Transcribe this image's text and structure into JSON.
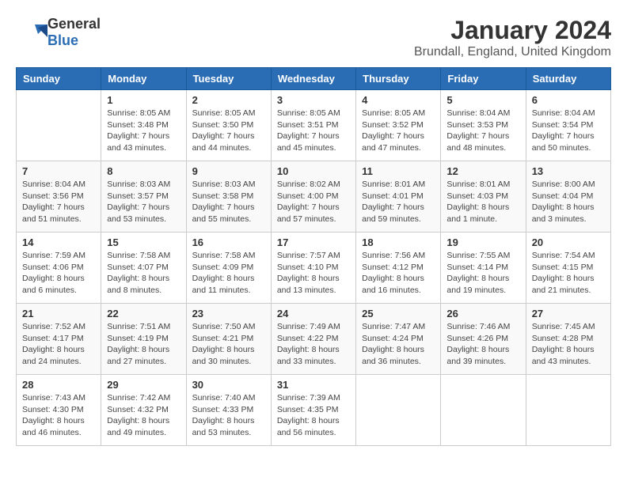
{
  "header": {
    "logo_general": "General",
    "logo_blue": "Blue",
    "month": "January 2024",
    "location": "Brundall, England, United Kingdom"
  },
  "days_of_week": [
    "Sunday",
    "Monday",
    "Tuesday",
    "Wednesday",
    "Thursday",
    "Friday",
    "Saturday"
  ],
  "weeks": [
    [
      {
        "day": "",
        "info": ""
      },
      {
        "day": "1",
        "info": "Sunrise: 8:05 AM\nSunset: 3:48 PM\nDaylight: 7 hours\nand 43 minutes."
      },
      {
        "day": "2",
        "info": "Sunrise: 8:05 AM\nSunset: 3:50 PM\nDaylight: 7 hours\nand 44 minutes."
      },
      {
        "day": "3",
        "info": "Sunrise: 8:05 AM\nSunset: 3:51 PM\nDaylight: 7 hours\nand 45 minutes."
      },
      {
        "day": "4",
        "info": "Sunrise: 8:05 AM\nSunset: 3:52 PM\nDaylight: 7 hours\nand 47 minutes."
      },
      {
        "day": "5",
        "info": "Sunrise: 8:04 AM\nSunset: 3:53 PM\nDaylight: 7 hours\nand 48 minutes."
      },
      {
        "day": "6",
        "info": "Sunrise: 8:04 AM\nSunset: 3:54 PM\nDaylight: 7 hours\nand 50 minutes."
      }
    ],
    [
      {
        "day": "7",
        "info": "Sunrise: 8:04 AM\nSunset: 3:56 PM\nDaylight: 7 hours\nand 51 minutes."
      },
      {
        "day": "8",
        "info": "Sunrise: 8:03 AM\nSunset: 3:57 PM\nDaylight: 7 hours\nand 53 minutes."
      },
      {
        "day": "9",
        "info": "Sunrise: 8:03 AM\nSunset: 3:58 PM\nDaylight: 7 hours\nand 55 minutes."
      },
      {
        "day": "10",
        "info": "Sunrise: 8:02 AM\nSunset: 4:00 PM\nDaylight: 7 hours\nand 57 minutes."
      },
      {
        "day": "11",
        "info": "Sunrise: 8:01 AM\nSunset: 4:01 PM\nDaylight: 7 hours\nand 59 minutes."
      },
      {
        "day": "12",
        "info": "Sunrise: 8:01 AM\nSunset: 4:03 PM\nDaylight: 8 hours\nand 1 minute."
      },
      {
        "day": "13",
        "info": "Sunrise: 8:00 AM\nSunset: 4:04 PM\nDaylight: 8 hours\nand 3 minutes."
      }
    ],
    [
      {
        "day": "14",
        "info": "Sunrise: 7:59 AM\nSunset: 4:06 PM\nDaylight: 8 hours\nand 6 minutes."
      },
      {
        "day": "15",
        "info": "Sunrise: 7:58 AM\nSunset: 4:07 PM\nDaylight: 8 hours\nand 8 minutes."
      },
      {
        "day": "16",
        "info": "Sunrise: 7:58 AM\nSunset: 4:09 PM\nDaylight: 8 hours\nand 11 minutes."
      },
      {
        "day": "17",
        "info": "Sunrise: 7:57 AM\nSunset: 4:10 PM\nDaylight: 8 hours\nand 13 minutes."
      },
      {
        "day": "18",
        "info": "Sunrise: 7:56 AM\nSunset: 4:12 PM\nDaylight: 8 hours\nand 16 minutes."
      },
      {
        "day": "19",
        "info": "Sunrise: 7:55 AM\nSunset: 4:14 PM\nDaylight: 8 hours\nand 19 minutes."
      },
      {
        "day": "20",
        "info": "Sunrise: 7:54 AM\nSunset: 4:15 PM\nDaylight: 8 hours\nand 21 minutes."
      }
    ],
    [
      {
        "day": "21",
        "info": "Sunrise: 7:52 AM\nSunset: 4:17 PM\nDaylight: 8 hours\nand 24 minutes."
      },
      {
        "day": "22",
        "info": "Sunrise: 7:51 AM\nSunset: 4:19 PM\nDaylight: 8 hours\nand 27 minutes."
      },
      {
        "day": "23",
        "info": "Sunrise: 7:50 AM\nSunset: 4:21 PM\nDaylight: 8 hours\nand 30 minutes."
      },
      {
        "day": "24",
        "info": "Sunrise: 7:49 AM\nSunset: 4:22 PM\nDaylight: 8 hours\nand 33 minutes."
      },
      {
        "day": "25",
        "info": "Sunrise: 7:47 AM\nSunset: 4:24 PM\nDaylight: 8 hours\nand 36 minutes."
      },
      {
        "day": "26",
        "info": "Sunrise: 7:46 AM\nSunset: 4:26 PM\nDaylight: 8 hours\nand 39 minutes."
      },
      {
        "day": "27",
        "info": "Sunrise: 7:45 AM\nSunset: 4:28 PM\nDaylight: 8 hours\nand 43 minutes."
      }
    ],
    [
      {
        "day": "28",
        "info": "Sunrise: 7:43 AM\nSunset: 4:30 PM\nDaylight: 8 hours\nand 46 minutes."
      },
      {
        "day": "29",
        "info": "Sunrise: 7:42 AM\nSunset: 4:32 PM\nDaylight: 8 hours\nand 49 minutes."
      },
      {
        "day": "30",
        "info": "Sunrise: 7:40 AM\nSunset: 4:33 PM\nDaylight: 8 hours\nand 53 minutes."
      },
      {
        "day": "31",
        "info": "Sunrise: 7:39 AM\nSunset: 4:35 PM\nDaylight: 8 hours\nand 56 minutes."
      },
      {
        "day": "",
        "info": ""
      },
      {
        "day": "",
        "info": ""
      },
      {
        "day": "",
        "info": ""
      }
    ]
  ]
}
